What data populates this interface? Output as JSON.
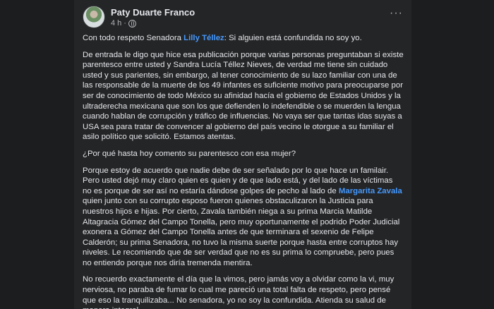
{
  "post": {
    "author": "Paty Duarte Franco",
    "time": "4 h",
    "time_separator": "·",
    "icons": {
      "privacy": "globe-icon",
      "menu": "more-options-icon"
    },
    "colors": {
      "background": "#242526",
      "text": "#e4e6eb",
      "mention": "#4599ff",
      "muted": "#b0b3b8"
    },
    "paragraphs": {
      "p1": {
        "before": "Con todo respeto Senadora ",
        "mention": "Lilly Téllez",
        "after": ": Si alguien está confundida no soy yo."
      },
      "p2": "De entrada le digo que hice esa publicación porque varias personas preguntaban si existe parentesco entre usted y Sandra Lucía Téllez Nieves, de verdad me tiene sin cuidado usted y sus parientes, sin embargo, al tener conocimiento de su lazo familiar con una de las responsable de la muerte de los 49 infantes es suficiente motivo para preocuparse por ser de conocimiento de todo México su afinidad hacía el gobierno de Estados Unidos y la ultraderecha mexicana que son los que defienden lo indefendible o se muerden la lengua cuando hablan de corrupción y tráfico de influencias. No vaya ser que tantas idas suyas a USA sea para tratar de convencer al gobierno del país vecino le otorgue a su familiar el asilo político que solicitó. Estamos atentas.",
      "p3": "¿Por qué hasta hoy  comento su parentesco con esa mujer?",
      "p4": {
        "before": "Porque estoy de acuerdo que nadie debe de ser señalado por lo que hace un familair. Pero usted dejó muy claro quien es quien y de que lado está, y del lado de las víctimas no es porque de ser así no estaría dándose golpes de pecho al lado de ",
        "mention": "Margarita Zavala",
        "after": " quien junto con su corrupto esposo fueron quienes obstaculizaron la Justicia para nuestros hijos e hijas. Por cierto, Zavala también niega a su prima Marcia Matilde Altagracia Gómez del Campo Tonella, pero muy oportunamente el podrido Poder Judicial exonera a Gómez del Campo Tonella antes de que terminara el sexenio de Felipe Calderón; su prima Senadora, no tuvo la misma suerte porque hasta entre corruptos hay niveles. Le recomiendo que de ser  verdad que no es su prima lo compruebe, pero pues no entiendo porque nos diría tremenda mentira."
      },
      "p5": "No recuerdo exactamente el día que la vimos, pero jamás voy a olvidar como la vi, muy nerviosa, no paraba de fumar lo cual me pareció una total falta de respeto, pero pensé que eso la tranquilizaba... No senadora, yo no soy la confundida. Atienda su salud de manera integral."
    }
  }
}
